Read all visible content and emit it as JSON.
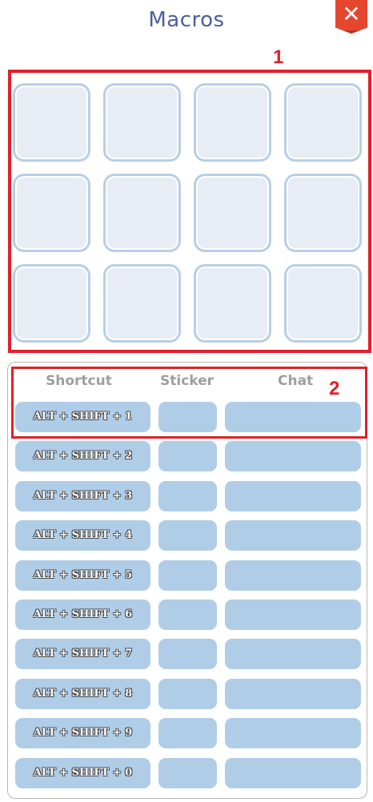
{
  "window": {
    "title": "Macros",
    "close_label": "✕"
  },
  "annotations": {
    "callout_1": "1",
    "callout_2": "2"
  },
  "sticker_grid": {
    "rows": 3,
    "columns": 4
  },
  "table": {
    "headers": {
      "shortcut": "Shortcut",
      "sticker": "Sticker",
      "chat": "Chat"
    },
    "rows": [
      {
        "shortcut": "ALT + SHIFT + 1"
      },
      {
        "shortcut": "ALT + SHIFT + 2"
      },
      {
        "shortcut": "ALT + SHIFT + 3"
      },
      {
        "shortcut": "ALT + SHIFT + 4"
      },
      {
        "shortcut": "ALT + SHIFT + 5"
      },
      {
        "shortcut": "ALT + SHIFT + 6"
      },
      {
        "shortcut": "ALT + SHIFT + 7"
      },
      {
        "shortcut": "ALT + SHIFT + 8"
      },
      {
        "shortcut": "ALT + SHIFT + 9"
      },
      {
        "shortcut": "ALT + SHIFT + 0"
      }
    ]
  },
  "colors": {
    "title": "#4a5f9c",
    "close_button": "#e5462e",
    "annotation": "#e0202a",
    "slot_fill": "#e8ecf4",
    "slot_border": "#b7cfe6",
    "row_cell": "#b0cde8",
    "header_text": "#9e9e9e"
  }
}
